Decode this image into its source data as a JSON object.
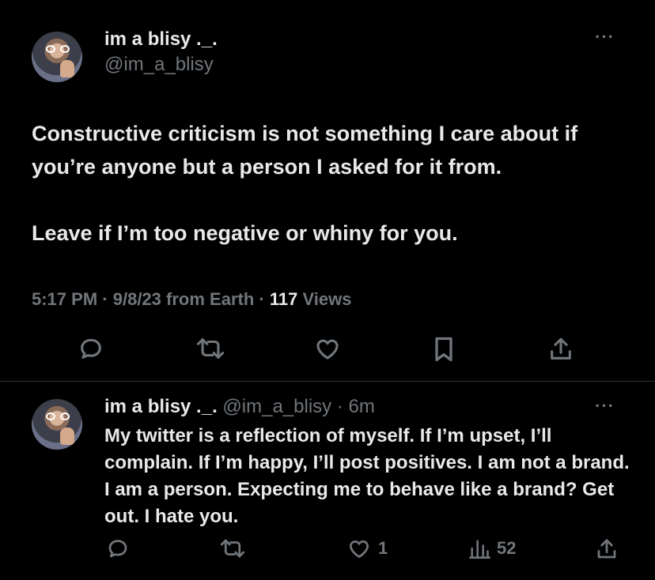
{
  "main_tweet": {
    "author_name": "im a blisy ._.",
    "author_handle": "@im_a_blisy",
    "more_label": "···",
    "text_lines": [
      "Constructive criticism is not something I care about if you’re anyone but a person I asked for it from.",
      "Leave if I’m too negative or whiny for you."
    ],
    "time": "5:17 PM",
    "date": "9/8/23",
    "source": "from Earth",
    "separator": "·",
    "views_count": "117",
    "views_label": "Views",
    "icons": [
      "reply-icon",
      "retweet-icon",
      "like-icon",
      "bookmark-icon",
      "share-icon"
    ]
  },
  "reply_tweet": {
    "author_name": "im a blisy ._.",
    "author_handle": "@im_a_blisy",
    "separator": "·",
    "age": "6m",
    "more_label": "···",
    "text": "My twitter is a reflection of myself. If I’m upset, I’ll complain. If I’m happy, I’ll post positives. I am not a brand. I am a person. Expecting me to behave like a brand? Get out. I hate you.",
    "like_count": "1",
    "views_count": "52",
    "icons": [
      "reply-icon",
      "retweet-icon",
      "like-icon",
      "views-icon",
      "share-icon"
    ]
  },
  "colors": {
    "background": "#000000",
    "text_primary": "#e7e9ea",
    "text_secondary": "#71767b",
    "divider": "#2f3336"
  }
}
